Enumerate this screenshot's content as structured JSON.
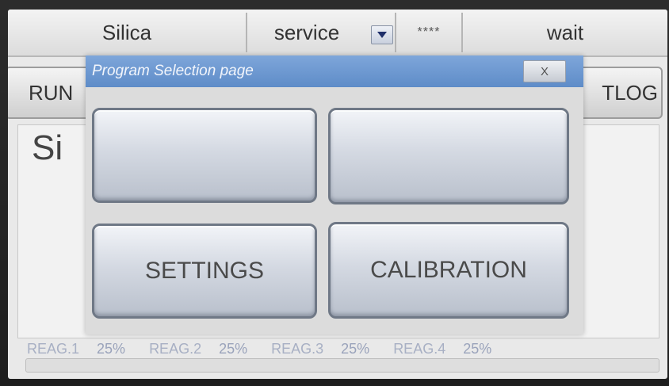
{
  "topbar": {
    "program": "Silica",
    "mode": "service",
    "password_mask": "****",
    "status": "wait"
  },
  "tabs": {
    "left_label": "RUN",
    "right_label": "TLOG"
  },
  "main": {
    "title_fragment": "Si"
  },
  "dialog": {
    "title": "Program Selection page",
    "close_label": "X",
    "buttons": {
      "top_left": "",
      "top_right": "",
      "settings": "SETTINGS",
      "calibration": "CALIBRATION"
    }
  },
  "reagents": [
    {
      "label": "REAG.1",
      "level": "25%"
    },
    {
      "label": "REAG.2",
      "level": "25%"
    },
    {
      "label": "REAG.3",
      "level": "25%"
    },
    {
      "label": "REAG.4",
      "level": "25%"
    }
  ],
  "colors": {
    "dialog_header": "#6d98d1",
    "reagent_text": "#a8b0c4"
  }
}
